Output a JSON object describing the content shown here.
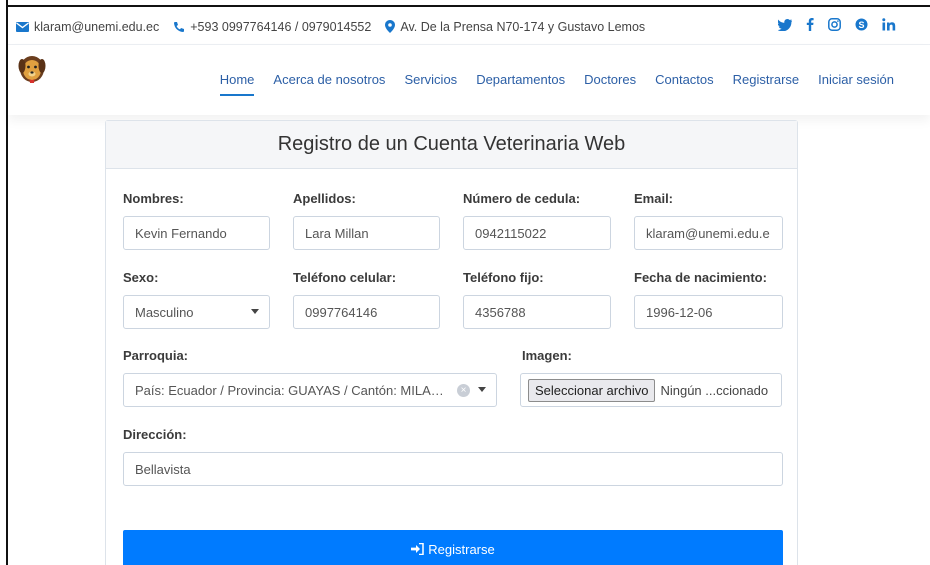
{
  "topbar": {
    "email": "klaram@unemi.edu.ec",
    "phone": "+593 0997764146 / 0979014552",
    "address": "Av. De la Prensa N70-174 y Gustavo Lemos"
  },
  "social": [
    "twitter-icon",
    "facebook-icon",
    "instagram-icon",
    "skype-icon",
    "linkedin-icon"
  ],
  "nav": {
    "items": [
      "Home",
      "Acerca de nosotros",
      "Servicios",
      "Departamentos",
      "Doctores",
      "Contactos",
      "Registrarse",
      "Iniciar sesión"
    ],
    "active": "Home"
  },
  "form": {
    "title": "Registro de un Cuenta Veterinaria Web",
    "nombres": {
      "label": "Nombres:",
      "value": "Kevin Fernando"
    },
    "apellidos": {
      "label": "Apellidos:",
      "value": "Lara Millan"
    },
    "cedula": {
      "label": "Número de cedula:",
      "value": "0942115022"
    },
    "email": {
      "label": "Email:",
      "value": "klaram@unemi.edu.e"
    },
    "sexo": {
      "label": "Sexo:",
      "value": "Masculino"
    },
    "celular": {
      "label": "Teléfono celular:",
      "value": "0997764146"
    },
    "fijo": {
      "label": "Teléfono fijo:",
      "value": "4356788"
    },
    "nacimiento": {
      "label": "Fecha de nacimiento:",
      "value": "1996-12-06"
    },
    "parroquia": {
      "label": "Parroquia:",
      "value": "País: Ecuador / Provincia: GUAYAS / Cantón: MILAGRO /..."
    },
    "imagen": {
      "label": "Imagen:",
      "button": "Seleccionar archivo",
      "status": "Ningún ...ccionado"
    },
    "direccion": {
      "label": "Dirección:",
      "value": "Bellavista"
    },
    "submit": "Registrarse"
  },
  "colors": {
    "primary": "#007bff",
    "nav_link": "#2c5fa6",
    "accent": "#1977cc"
  }
}
